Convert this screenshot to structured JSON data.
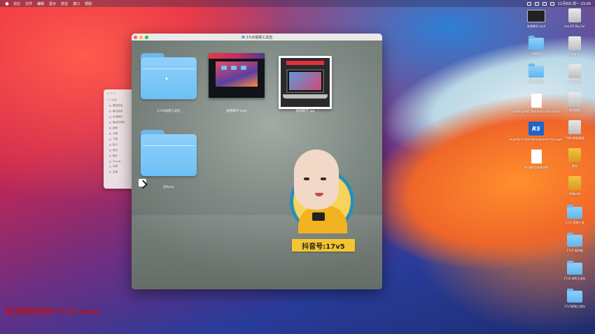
{
  "menubar": {
    "items": [
      "访达",
      "文件",
      "编辑",
      "显示",
      "前往",
      "窗口",
      "帮助"
    ],
    "clock": "11月8日 周一 23:00"
  },
  "window": {
    "title": "17v5视频工具包",
    "items": [
      {
        "label": "17v5视频工具包",
        "type": "folder"
      },
      {
        "label": "视频教学.mp4",
        "type": "video"
      },
      {
        "label": "视频教学.jpg",
        "type": "image"
      },
      {
        "label": "Effects",
        "type": "folder-alias"
      }
    ],
    "badge": "抖音号:17v5"
  },
  "finder_sidebar": {
    "section": "个人收藏",
    "items": [
      "隔空投送",
      "最近使用",
      "应用程序",
      "最近的项目",
      "桌面",
      "文稿",
      "下载",
      "影片",
      "音乐",
      "图片",
      "iCloud",
      "共享",
      "位置"
    ]
  },
  "desktop_icons": {
    "col1": [
      "安装教学.mp4",
      "压缩插件",
      "第三方插件",
      "Xinfang Mac Tool (wps) 4t4 s0 key",
      "HighPoint Disk Management Manager",
      "PS 插件包安装说明"
    ],
    "col2": [
      "macOS Big Sur",
      "系统 A",
      "下载的东西",
      "备用磁盘",
      "FINAL数据磁盘",
      "素材",
      "WINLAN",
      "17v5 图像工具",
      "17v5 插件箱",
      "17v5 调色工具包",
      "17v5视频工具包"
    ]
  },
  "watermark": "更多精品资源:17v5.shop"
}
